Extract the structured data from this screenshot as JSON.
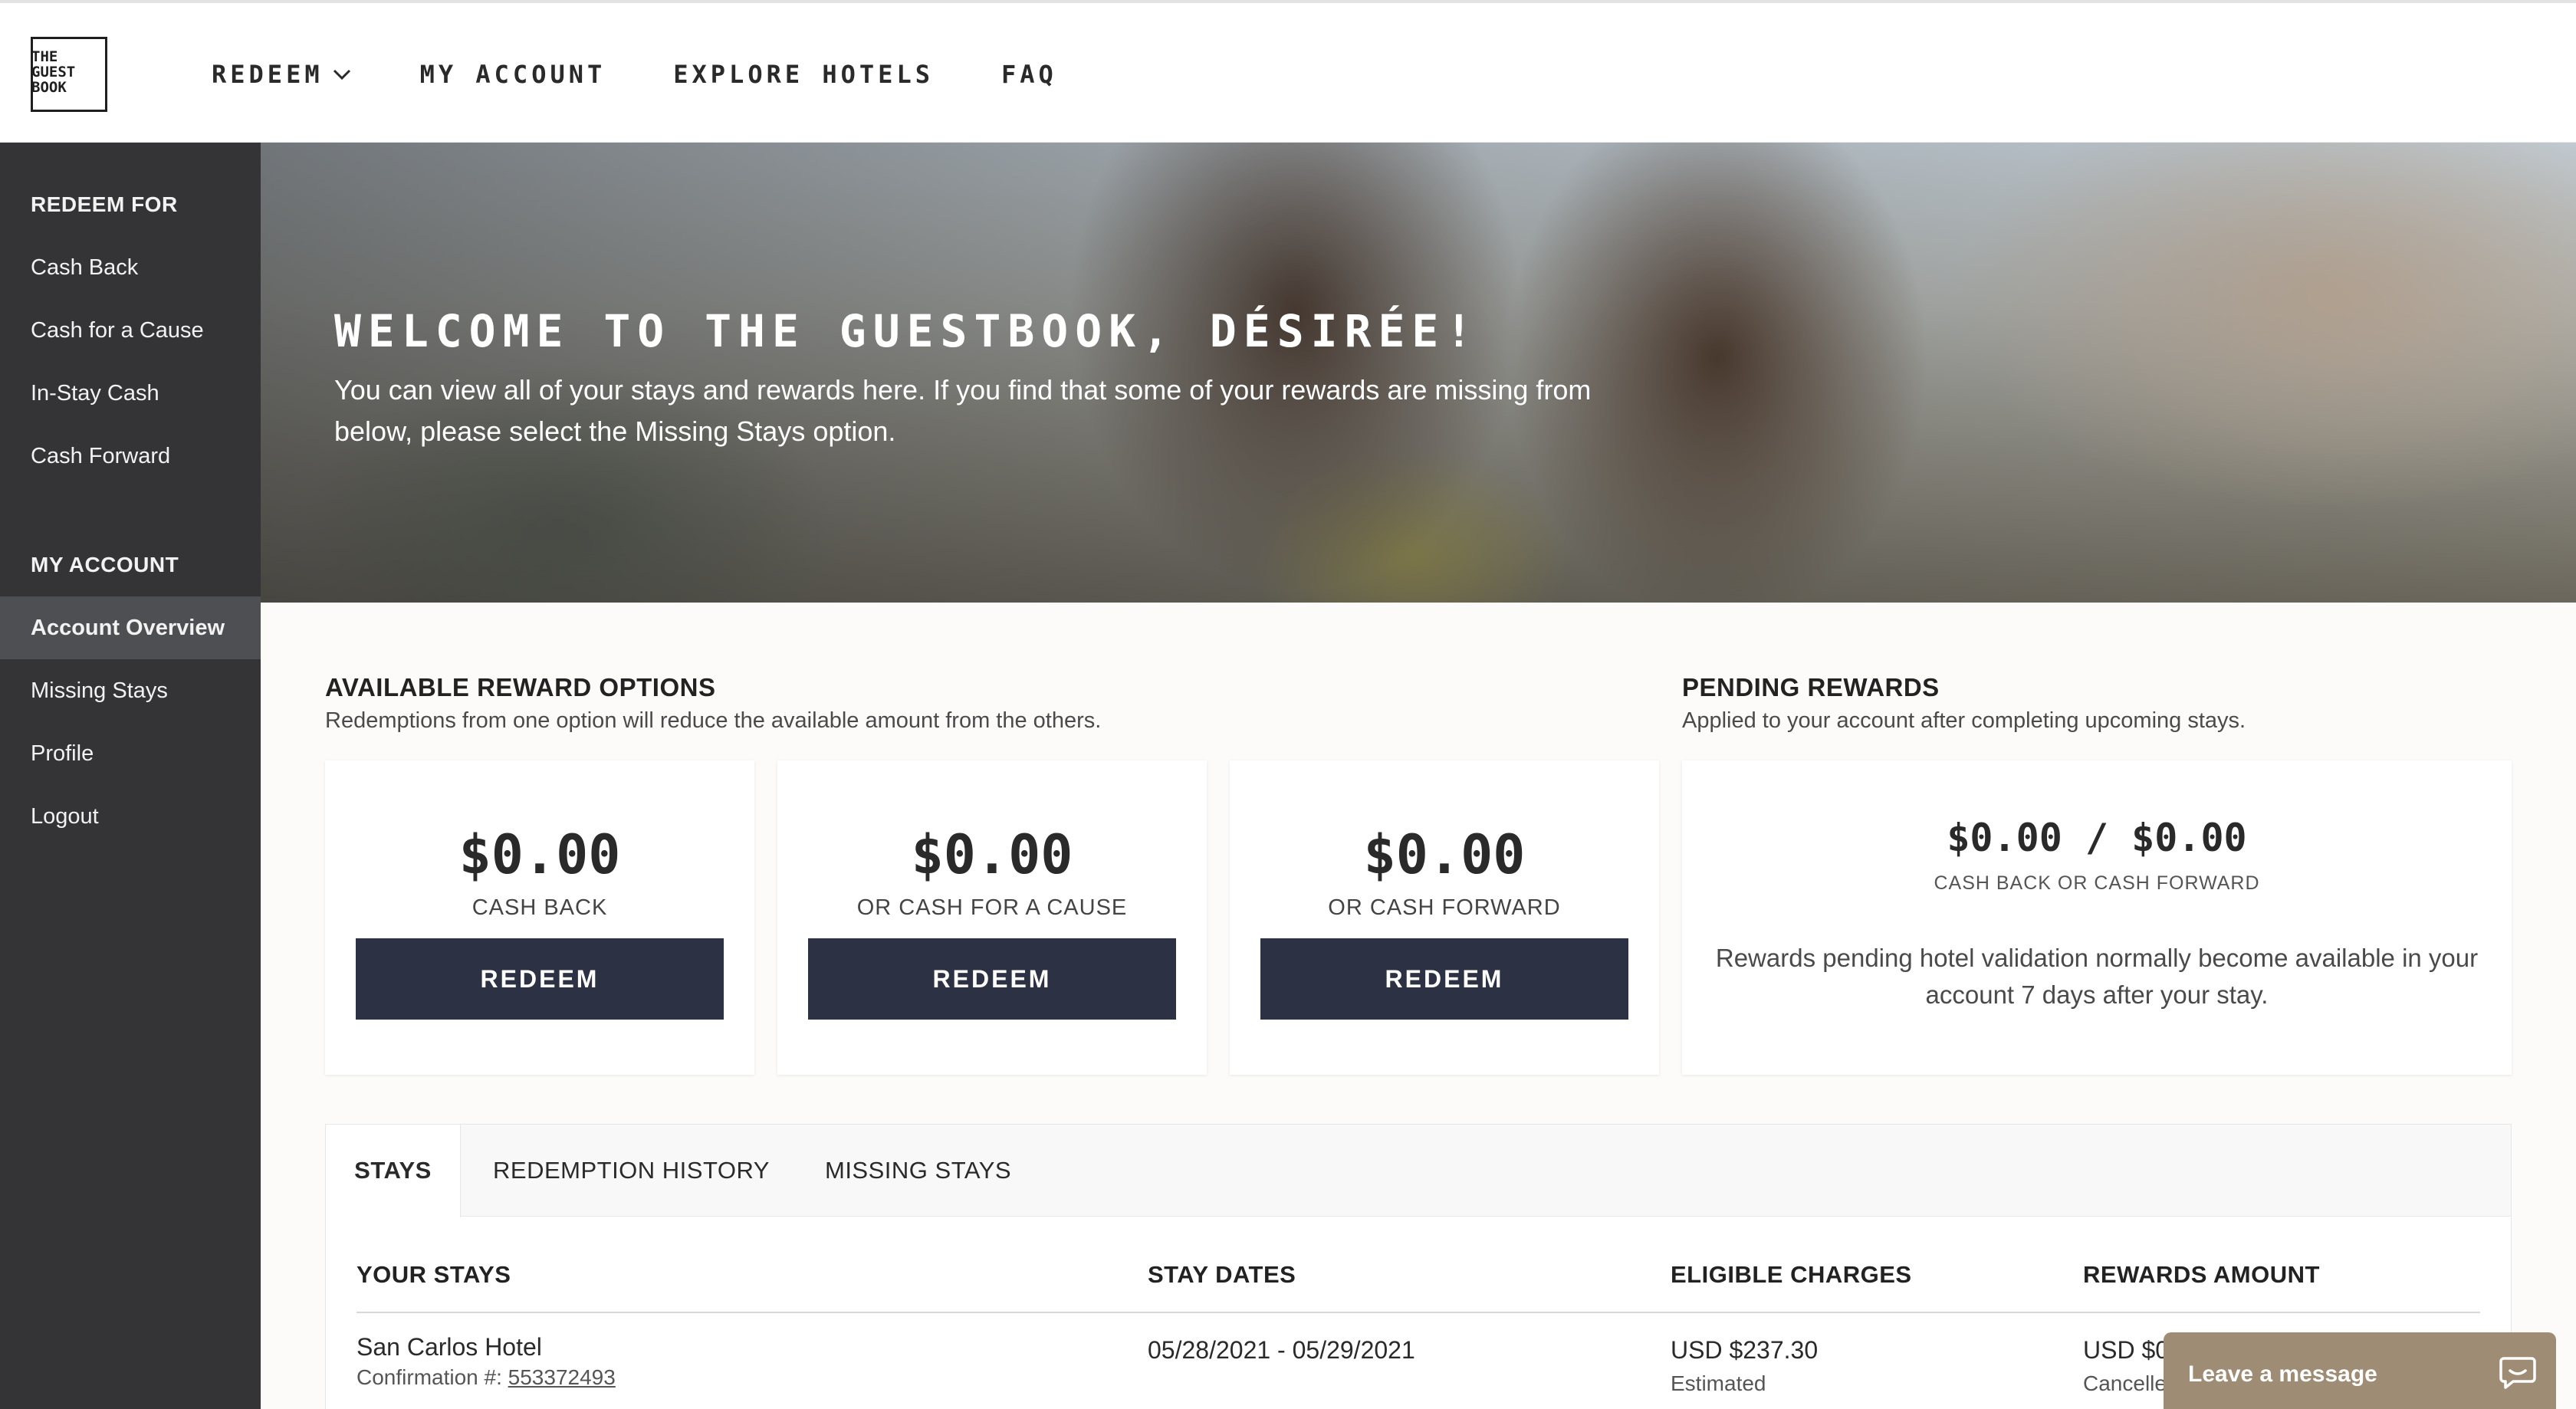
{
  "logo": {
    "lines": [
      "THE",
      "GUEST",
      "BOOK"
    ]
  },
  "nav": {
    "redeem": "REDEEM",
    "my_account": "MY ACCOUNT",
    "explore_hotels": "EXPLORE HOTELS",
    "faq": "FAQ"
  },
  "sidebar": {
    "redeem_heading": "REDEEM FOR",
    "redeem_items": [
      "Cash Back",
      "Cash for a Cause",
      "In-Stay Cash",
      "Cash Forward"
    ],
    "account_heading": "MY ACCOUNT",
    "account_items": [
      "Account Overview",
      "Missing Stays",
      "Profile",
      "Logout"
    ],
    "active_item": "Account Overview"
  },
  "hero": {
    "title": "WELCOME TO THE GUESTBOOK, DÉSIRÉE!",
    "subtitle": "You can view all of your stays and rewards here. If you find that some of your rewards are missing from below, please select the Missing Stays option."
  },
  "available": {
    "title": "AVAILABLE REWARD OPTIONS",
    "subtitle": "Redemptions from one option will reduce the available amount from the others.",
    "cards": [
      {
        "amount": "$0.00",
        "label": "CASH BACK",
        "button": "REDEEM"
      },
      {
        "amount": "$0.00",
        "label": "OR CASH FOR A CAUSE",
        "button": "REDEEM"
      },
      {
        "amount": "$0.00",
        "label": "OR CASH FORWARD",
        "button": "REDEEM"
      }
    ]
  },
  "pending": {
    "title": "PENDING REWARDS",
    "subtitle": "Applied to your account after completing upcoming stays.",
    "amount": "$0.00 /  $0.00",
    "label": "CASH BACK OR CASH FORWARD",
    "note": "Rewards pending hotel validation normally become available in your account 7 days after your stay."
  },
  "stays": {
    "tabs": [
      "STAYS",
      "REDEMPTION HISTORY",
      "MISSING STAYS"
    ],
    "active_tab": "STAYS",
    "columns": [
      "YOUR STAYS",
      "STAY DATES",
      "ELIGIBLE CHARGES",
      "REWARDS AMOUNT"
    ],
    "rows": [
      {
        "hotel": "San Carlos Hotel",
        "confirmation_label": "Confirmation #:",
        "confirmation": "553372493",
        "dates": "05/28/2021 - 05/29/2021",
        "charges": "USD $237.30",
        "charges_note": "Estimated",
        "reward": "USD $0",
        "reward_note": "Cancelle"
      }
    ]
  },
  "chat": {
    "label": "Leave a message"
  },
  "colors": {
    "sidebar_bg": "#343436",
    "sidebar_active": "#4e4f52",
    "button_bg": "#2c3143",
    "chat_bg": "#9e8c74"
  }
}
